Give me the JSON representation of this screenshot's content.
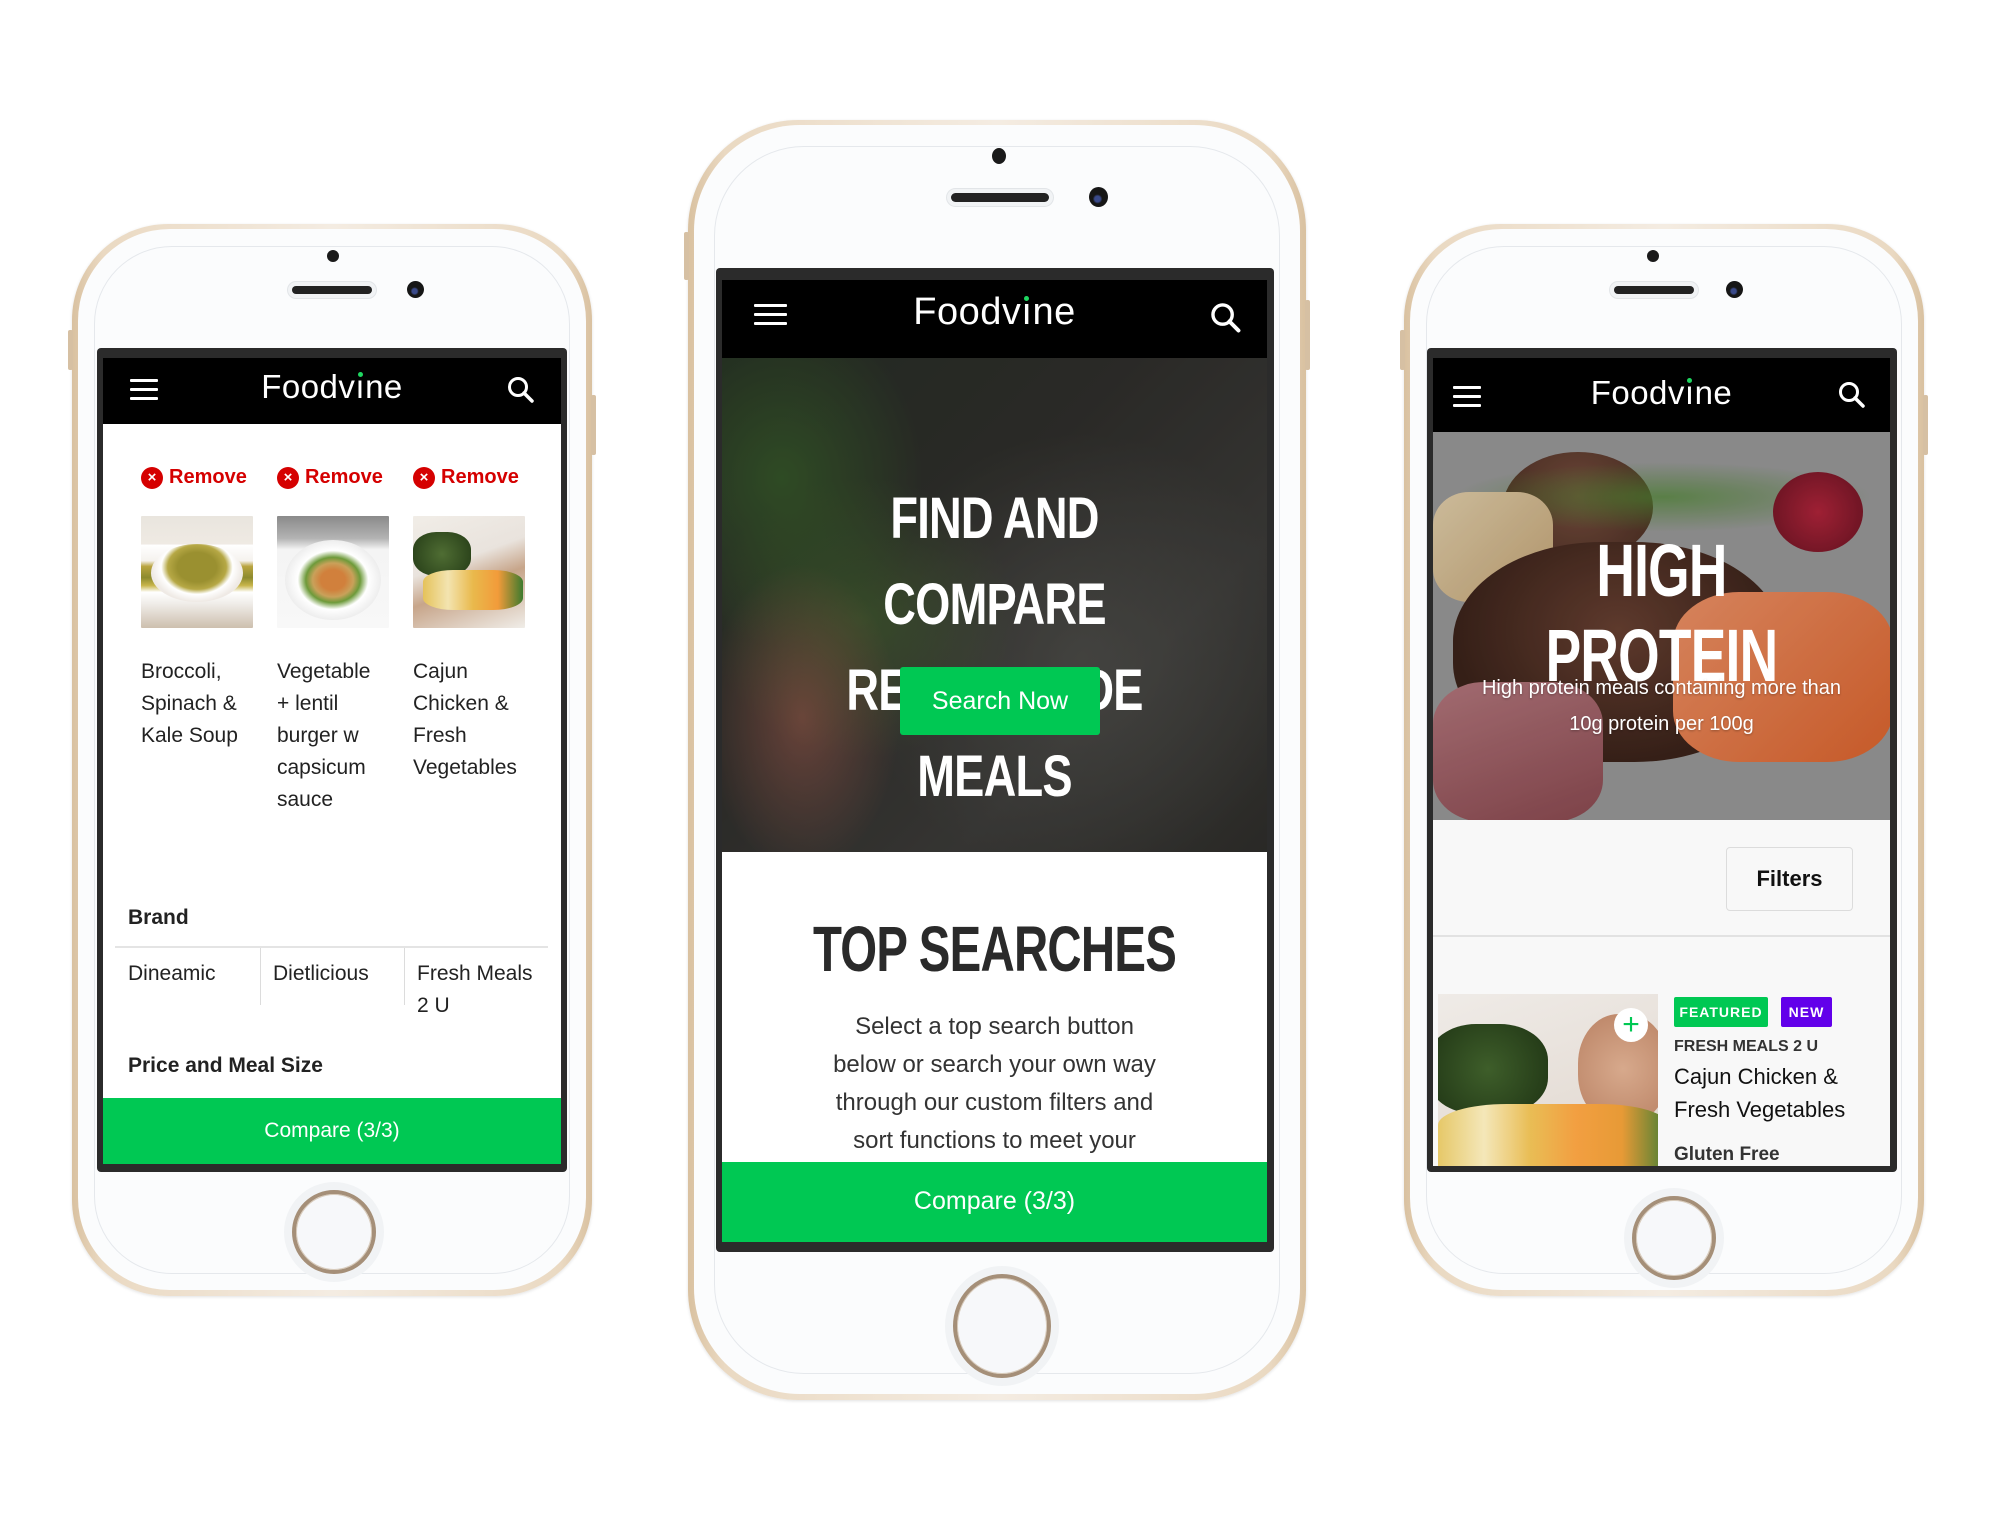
{
  "app": {
    "name": "Foodvine",
    "brand_green": "#00c853",
    "remove_red": "#d50000",
    "new_purple": "#6200ea"
  },
  "icons": {
    "menu": "hamburger-menu-icon",
    "search": "search-icon",
    "remove": "close-circle-icon",
    "add": "plus-icon"
  },
  "left_phone": {
    "header": {
      "logo": "Foodvine"
    },
    "compare_items": [
      {
        "remove_label": "Remove",
        "name": "Broccoli, Spinach & Kale Soup",
        "name_lines": [
          "Broccoli,",
          "Spinach &",
          "Kale Soup"
        ]
      },
      {
        "remove_label": "Remove",
        "name": "Vegetable + lentil burger w capsicum sauce",
        "name_lines": [
          "Vegetable",
          "+ lentil",
          "burger w",
          "capsicum",
          "sauce"
        ]
      },
      {
        "remove_label": "Remove",
        "name": "Cajun Chicken & Fresh Vegetables",
        "name_lines": [
          "Cajun",
          "Chicken &",
          "Fresh",
          "Vegetables"
        ]
      }
    ],
    "brand_section": {
      "label": "Brand",
      "values": [
        {
          "lines": [
            "Dineamic"
          ]
        },
        {
          "lines": [
            "Dietlicious"
          ]
        },
        {
          "lines": [
            "Fresh Meals",
            "2 U"
          ]
        }
      ]
    },
    "price_section": {
      "label": "Price and Meal Size"
    },
    "compare_button": "Compare (3/3)"
  },
  "center_phone": {
    "header": {
      "logo": "Foodvine"
    },
    "hero": {
      "title_line1": "FIND AND COMPARE",
      "title_line2": "READY-MADE MEALS",
      "cta": "Search Now"
    },
    "top_searches": {
      "title": "TOP SEARCHES",
      "body_lines": [
        "Select a top search button",
        "below or search your own way",
        "through our custom filters and",
        "sort functions to meet your"
      ]
    },
    "compare_button": "Compare (3/3)"
  },
  "right_phone": {
    "header": {
      "logo": "Foodvine"
    },
    "hero": {
      "title": "HIGH PROTEIN",
      "subtitle_line1": "High protein meals containing more than",
      "subtitle_line2": "10g protein per 100g"
    },
    "filters_button": "Filters",
    "meal_card": {
      "badges": [
        "FEATURED",
        "NEW"
      ],
      "brand": "FRESH MEALS 2 U",
      "name_line1": "Cajun Chicken &",
      "name_line2": "Fresh Vegetables",
      "tag": "Gluten Free"
    }
  }
}
